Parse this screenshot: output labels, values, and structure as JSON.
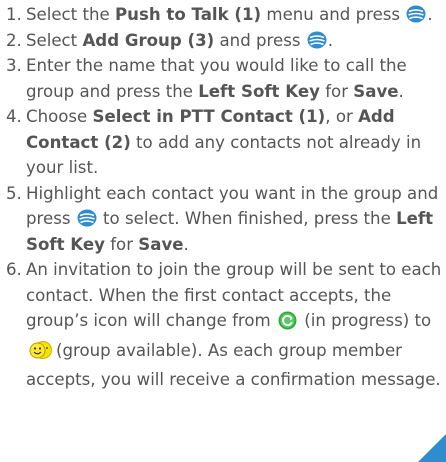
{
  "steps": [
    {
      "num": "1.",
      "parts": [
        "Select the ",
        "Push to Talk (1)",
        " menu and press ",
        "",
        "."
      ]
    },
    {
      "num": "2.",
      "parts": [
        "Select ",
        "Add Group (3)",
        " and press ",
        "",
        "."
      ]
    },
    {
      "num": "3.",
      "parts": [
        "Enter the name that you would like to call the group and press the ",
        "Left Soft Key",
        " for ",
        "Save",
        "."
      ]
    },
    {
      "num": "4.",
      "parts": [
        "Choose ",
        "Select in PTT Contact (1)",
        ", or ",
        "Add Contact (2)",
        " to add any contacts not already in your list."
      ]
    },
    {
      "num": "5.",
      "parts": [
        "Highlight each contact you want in the group and press ",
        "",
        " to select. When finished, press the ",
        "Left Soft Key",
        " for ",
        "Save",
        "."
      ]
    },
    {
      "num": "6.",
      "parts": [
        "An invitation to join the group will be sent to each contact. When the first contact accepts, the group’s icon will change from ",
        "",
        " (in progress) to ",
        "",
        "(group available). As each group member accepts, you will receive a confirmation message."
      ]
    }
  ],
  "icons": {
    "ok_key": "ok-key-icon",
    "in_progress": "in-progress-icon",
    "group_available": "group-available-icon"
  },
  "colors": {
    "text": "#555555",
    "key_blue": "#2f8ccf",
    "progress_green": "#2eaa3c",
    "available_yellow": "#f5e200"
  }
}
